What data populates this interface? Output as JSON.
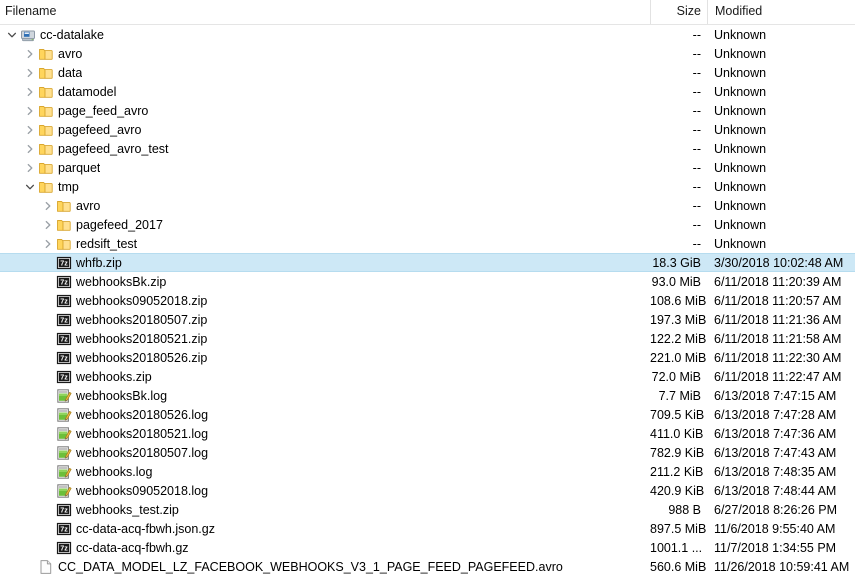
{
  "columns": {
    "filename": "Filename",
    "size": "Size",
    "modified": "Modified",
    "sort_indicator": "sort-ascending-arrow"
  },
  "colors": {
    "selection_bg": "#cde8f6",
    "selection_border": "#b6dcef",
    "folder": "#ffd34d",
    "header_divider": "#e2e2e2"
  },
  "rows": [
    {
      "name": "cc-datalake",
      "size": "--",
      "modified": "Unknown",
      "icon": "drive-icon",
      "depth": 0,
      "twisty": "expanded",
      "selected": false
    },
    {
      "name": "avro",
      "size": "--",
      "modified": "Unknown",
      "icon": "folder-icon",
      "depth": 1,
      "twisty": "collapsed",
      "selected": false
    },
    {
      "name": "data",
      "size": "--",
      "modified": "Unknown",
      "icon": "folder-icon",
      "depth": 1,
      "twisty": "collapsed",
      "selected": false
    },
    {
      "name": "datamodel",
      "size": "--",
      "modified": "Unknown",
      "icon": "folder-icon",
      "depth": 1,
      "twisty": "collapsed",
      "selected": false
    },
    {
      "name": "page_feed_avro",
      "size": "--",
      "modified": "Unknown",
      "icon": "folder-icon",
      "depth": 1,
      "twisty": "collapsed",
      "selected": false
    },
    {
      "name": "pagefeed_avro",
      "size": "--",
      "modified": "Unknown",
      "icon": "folder-icon",
      "depth": 1,
      "twisty": "collapsed",
      "selected": false
    },
    {
      "name": "pagefeed_avro_test",
      "size": "--",
      "modified": "Unknown",
      "icon": "folder-icon",
      "depth": 1,
      "twisty": "collapsed",
      "selected": false
    },
    {
      "name": "parquet",
      "size": "--",
      "modified": "Unknown",
      "icon": "folder-icon",
      "depth": 1,
      "twisty": "collapsed",
      "selected": false
    },
    {
      "name": "tmp",
      "size": "--",
      "modified": "Unknown",
      "icon": "folder-icon",
      "depth": 1,
      "twisty": "expanded",
      "selected": false
    },
    {
      "name": "avro",
      "size": "--",
      "modified": "Unknown",
      "icon": "folder-icon",
      "depth": 2,
      "twisty": "collapsed",
      "selected": false
    },
    {
      "name": "pagefeed_2017",
      "size": "--",
      "modified": "Unknown",
      "icon": "folder-icon",
      "depth": 2,
      "twisty": "collapsed",
      "selected": false
    },
    {
      "name": "redsift_test",
      "size": "--",
      "modified": "Unknown",
      "icon": "folder-icon",
      "depth": 2,
      "twisty": "collapsed",
      "selected": false
    },
    {
      "name": "whfb.zip",
      "size": "18.3 GiB",
      "modified": "3/30/2018 10:02:48 AM",
      "icon": "sevenzip-icon",
      "depth": 2,
      "twisty": "none",
      "selected": true
    },
    {
      "name": "webhooksBk.zip",
      "size": "93.0 MiB",
      "modified": "6/11/2018 11:20:39 AM",
      "icon": "sevenzip-icon",
      "depth": 2,
      "twisty": "none",
      "selected": false
    },
    {
      "name": "webhooks09052018.zip",
      "size": "108.6 MiB",
      "modified": "6/11/2018 11:20:57 AM",
      "icon": "sevenzip-icon",
      "depth": 2,
      "twisty": "none",
      "selected": false
    },
    {
      "name": "webhooks20180507.zip",
      "size": "197.3 MiB",
      "modified": "6/11/2018 11:21:36 AM",
      "icon": "sevenzip-icon",
      "depth": 2,
      "twisty": "none",
      "selected": false
    },
    {
      "name": "webhooks20180521.zip",
      "size": "122.2 MiB",
      "modified": "6/11/2018 11:21:58 AM",
      "icon": "sevenzip-icon",
      "depth": 2,
      "twisty": "none",
      "selected": false
    },
    {
      "name": "webhooks20180526.zip",
      "size": "221.0 MiB",
      "modified": "6/11/2018 11:22:30 AM",
      "icon": "sevenzip-icon",
      "depth": 2,
      "twisty": "none",
      "selected": false
    },
    {
      "name": "webhooks.zip",
      "size": "72.0 MiB",
      "modified": "6/11/2018 11:22:47 AM",
      "icon": "sevenzip-icon",
      "depth": 2,
      "twisty": "none",
      "selected": false
    },
    {
      "name": "webhooksBk.log",
      "size": "7.7 MiB",
      "modified": "6/13/2018 7:47:15 AM",
      "icon": "log-file-icon",
      "depth": 2,
      "twisty": "none",
      "selected": false
    },
    {
      "name": "webhooks20180526.log",
      "size": "709.5 KiB",
      "modified": "6/13/2018 7:47:28 AM",
      "icon": "log-file-icon",
      "depth": 2,
      "twisty": "none",
      "selected": false
    },
    {
      "name": "webhooks20180521.log",
      "size": "411.0 KiB",
      "modified": "6/13/2018 7:47:36 AM",
      "icon": "log-file-icon",
      "depth": 2,
      "twisty": "none",
      "selected": false
    },
    {
      "name": "webhooks20180507.log",
      "size": "782.9 KiB",
      "modified": "6/13/2018 7:47:43 AM",
      "icon": "log-file-icon",
      "depth": 2,
      "twisty": "none",
      "selected": false
    },
    {
      "name": "webhooks.log",
      "size": "211.2 KiB",
      "modified": "6/13/2018 7:48:35 AM",
      "icon": "log-file-icon",
      "depth": 2,
      "twisty": "none",
      "selected": false
    },
    {
      "name": "webhooks09052018.log",
      "size": "420.9 KiB",
      "modified": "6/13/2018 7:48:44 AM",
      "icon": "log-file-icon",
      "depth": 2,
      "twisty": "none",
      "selected": false
    },
    {
      "name": "webhooks_test.zip",
      "size": "988 B",
      "modified": "6/27/2018 8:26:26 PM",
      "icon": "sevenzip-icon",
      "depth": 2,
      "twisty": "none",
      "selected": false
    },
    {
      "name": "cc-data-acq-fbwh.json.gz",
      "size": "897.5 MiB",
      "modified": "11/6/2018 9:55:40 AM",
      "icon": "sevenzip-icon",
      "depth": 2,
      "twisty": "none",
      "selected": false
    },
    {
      "name": "cc-data-acq-fbwh.gz",
      "size": "1001.1 ...",
      "modified": "11/7/2018 1:34:55 PM",
      "icon": "sevenzip-icon",
      "depth": 2,
      "twisty": "none",
      "selected": false
    },
    {
      "name": "CC_DATA_MODEL_LZ_FACEBOOK_WEBHOOKS_V3_1_PAGE_FEED_PAGEFEED.avro",
      "size": "560.6 MiB",
      "modified": "11/26/2018 10:59:41 AM",
      "icon": "generic-file-icon",
      "depth": 1,
      "twisty": "none",
      "selected": false
    }
  ]
}
